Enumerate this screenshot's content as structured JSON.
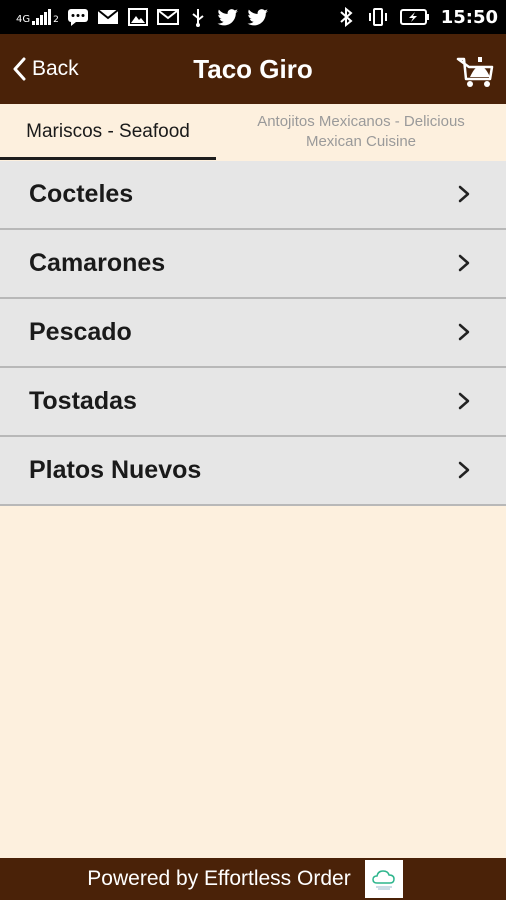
{
  "status_bar": {
    "network": "4G",
    "sim_index": "2",
    "time": "15:50",
    "icons": [
      "signal-icon",
      "chat-icon",
      "mail-icon",
      "image-icon",
      "gmail-icon",
      "usb-icon",
      "twitter-icon",
      "twitter-icon",
      "bluetooth-icon",
      "vibrate-icon",
      "battery-charging-icon"
    ]
  },
  "header": {
    "back_label": "Back",
    "title": "Taco Giro",
    "cart_icon": "cart-icon",
    "background": "#4a2208"
  },
  "tabs": [
    {
      "label": "Mariscos - Seafood",
      "selected": true
    },
    {
      "label": "Antojitos Mexicanos - Delicious Mexican Cuisine",
      "selected": false
    }
  ],
  "menu": {
    "items": [
      {
        "label": "Cocteles"
      },
      {
        "label": "Camarones"
      },
      {
        "label": "Pescado"
      },
      {
        "label": "Tostadas"
      },
      {
        "label": "Platos Nuevos"
      }
    ]
  },
  "footer": {
    "powered_by": "Powered by Effortless Order",
    "logo_icon": "effortless-order-logo"
  },
  "colors": {
    "brand_brown": "#4a2208",
    "page_background": "#fdf0de",
    "list_item_background": "#e6e6e6"
  }
}
